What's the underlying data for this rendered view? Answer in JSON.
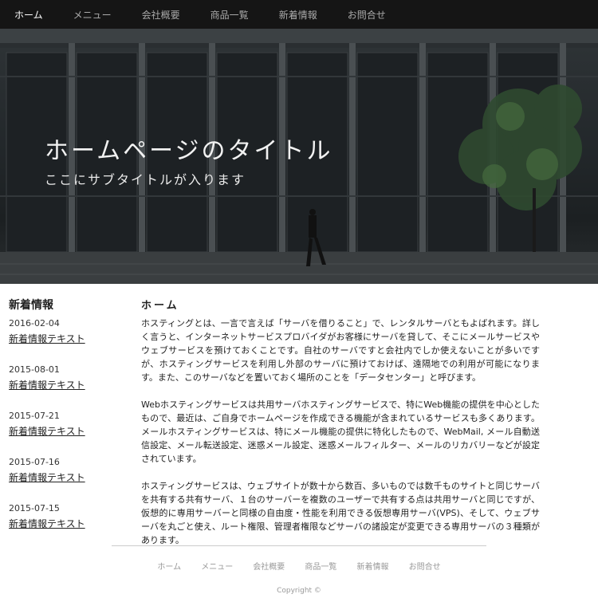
{
  "nav": {
    "items": [
      "ホーム",
      "メニュー",
      "会社概要",
      "商品一覧",
      "新着情報",
      "お問合せ"
    ],
    "active": "ホーム"
  },
  "hero": {
    "title": "ホームページのタイトル",
    "subtitle": "ここにサブタイトルが入ります"
  },
  "sidebar": {
    "title": "新着情報",
    "items": [
      {
        "date": "2016-02-04",
        "text": "新着情報テキスト"
      },
      {
        "date": "2015-08-01",
        "text": "新着情報テキスト"
      },
      {
        "date": "2015-07-21",
        "text": "新着情報テキスト"
      },
      {
        "date": "2015-07-16",
        "text": "新着情報テキスト"
      },
      {
        "date": "2015-07-15",
        "text": "新着情報テキスト"
      }
    ]
  },
  "main": {
    "title": "ホーム",
    "paragraphs": [
      "ホスティングとは、一言で言えば「サーバを借りること」で、レンタルサーバともよばれます。詳しく言うと、インターネットサービスプロバイダがお客様にサーバを貸して、そこにメールサービスやウェブサービスを預けておくことです。自社のサーバですと会社内でしか使えないことが多いですが、ホスティングサービスを利用し外部のサーバに預けておけば、遠隔地での利用が可能になります。また、このサーバなどを置いておく場所のことを「データセンター」と呼びます。",
      "Webホスティングサービスは共用サーバホスティングサービスで、特にWeb機能の提供を中心としたもので、最近は、ご自身でホームページを作成できる機能が含まれているサービスも多くあります。メールホスティングサービスは、特にメール機能の提供に特化したもので、WebMail, メール自動送信設定、メール転送設定、迷惑メール設定、迷惑メールフィルター、メールのリカバリーなどが設定されています。",
      "ホスティングサービスは、ウェブサイトが数十から数百、多いものでは数千ものサイトと同じサーバを共有する共有サーバ、１台のサーバーを複数のユーザーで共有する点は共用サーバと同じですが、仮想的に専用サーバーと同様の自由度・性能を利用できる仮想専用サーバ(VPS)、そして、ウェブサーバを丸ごと使え、ルート権限、管理者権限などサーバの諸設定が変更できる専用サーバの３種類があります。"
    ]
  },
  "footer": {
    "nav": [
      "ホーム",
      "メニュー",
      "会社概要",
      "商品一覧",
      "新着情報",
      "お問合せ"
    ],
    "copyright": "Copyright ©"
  }
}
